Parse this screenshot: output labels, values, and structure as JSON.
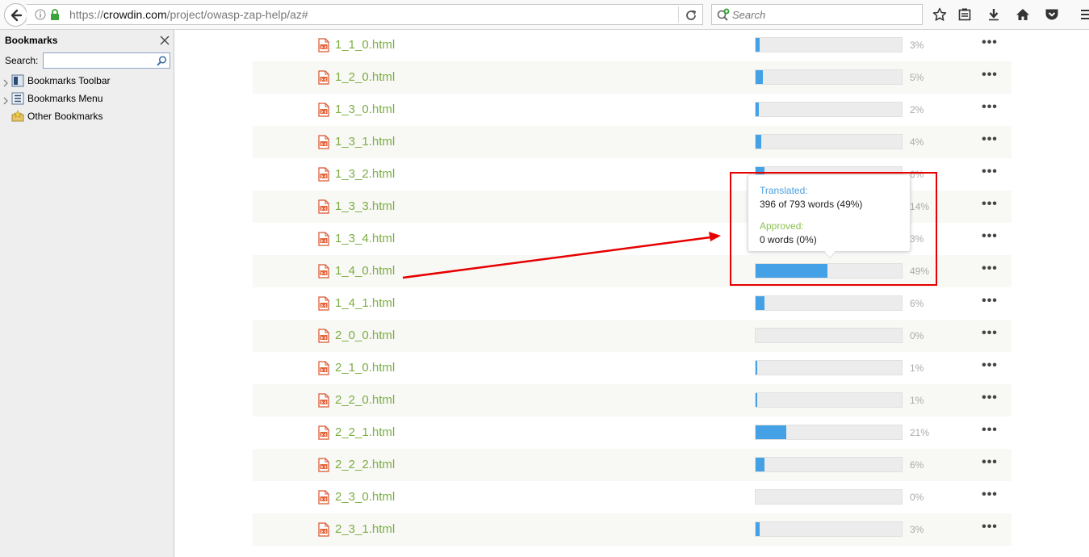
{
  "browser": {
    "url_scheme": "https://",
    "url_host": "crowdin.com",
    "url_path": "/project/owasp-zap-help/az#",
    "search_placeholder": "Search"
  },
  "sidebar": {
    "title": "Bookmarks",
    "search_label": "Search:",
    "items": [
      {
        "label": "Bookmarks Toolbar",
        "icon": "bookmarks-toolbar-icon"
      },
      {
        "label": "Bookmarks Menu",
        "icon": "bookmarks-menu-icon"
      },
      {
        "label": "Other Bookmarks",
        "icon": "other-bookmarks-icon"
      }
    ]
  },
  "files": [
    {
      "name": "1_1_0.html",
      "percent": 3,
      "percent_text": "3%"
    },
    {
      "name": "1_2_0.html",
      "percent": 5,
      "percent_text": "5%"
    },
    {
      "name": "1_3_0.html",
      "percent": 2,
      "percent_text": "2%"
    },
    {
      "name": "1_3_1.html",
      "percent": 4,
      "percent_text": "4%"
    },
    {
      "name": "1_3_2.html",
      "percent": 6,
      "percent_text": "6%"
    },
    {
      "name": "1_3_3.html",
      "percent": 14,
      "percent_text": "14%"
    },
    {
      "name": "1_3_4.html",
      "percent": 3,
      "percent_text": "3%"
    },
    {
      "name": "1_4_0.html",
      "percent": 49,
      "percent_text": "49%"
    },
    {
      "name": "1_4_1.html",
      "percent": 6,
      "percent_text": "6%"
    },
    {
      "name": "2_0_0.html",
      "percent": 0,
      "percent_text": "0%"
    },
    {
      "name": "2_1_0.html",
      "percent": 1,
      "percent_text": "1%"
    },
    {
      "name": "2_2_0.html",
      "percent": 1,
      "percent_text": "1%"
    },
    {
      "name": "2_2_1.html",
      "percent": 21,
      "percent_text": "21%"
    },
    {
      "name": "2_2_2.html",
      "percent": 6,
      "percent_text": "6%"
    },
    {
      "name": "2_3_0.html",
      "percent": 0,
      "percent_text": "0%"
    },
    {
      "name": "2_3_1.html",
      "percent": 3,
      "percent_text": "3%"
    }
  ],
  "tooltip": {
    "translated_label": "Translated:",
    "translated_value": "396 of 793 words (49%)",
    "approved_label": "Approved:",
    "approved_value": "0 words (0%)"
  },
  "colors": {
    "link_green": "#7cae45",
    "progress_blue": "#44a1e6",
    "annotation_red": "#e60000",
    "translated_label_blue": "#4a9fe0",
    "approved_label_green": "#8cc152"
  }
}
